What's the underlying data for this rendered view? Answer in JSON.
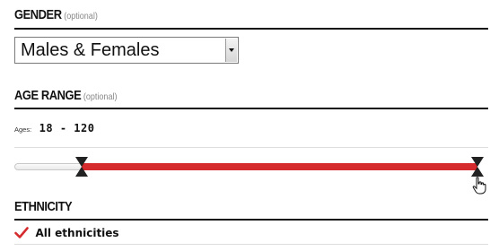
{
  "gender": {
    "title": "GENDER",
    "optional": "(optional)",
    "select_value": "Males & Females",
    "select_icon": "chevron-down-icon"
  },
  "age_range": {
    "title": "AGE RANGE",
    "optional": "(optional)",
    "ages_label": "Ages:",
    "ages_value": "18 - 120",
    "slider": {
      "min_value": 18,
      "max_value": 120,
      "fill_start_fraction": 0.145,
      "fill_end_fraction": 1.0
    },
    "fill_color": "#d52b2e"
  },
  "ethnicity": {
    "title": "ETHNICITY",
    "checkbox_label": "All ethnicities",
    "checkbox_checked": true,
    "check_color": "#d52b2e"
  }
}
